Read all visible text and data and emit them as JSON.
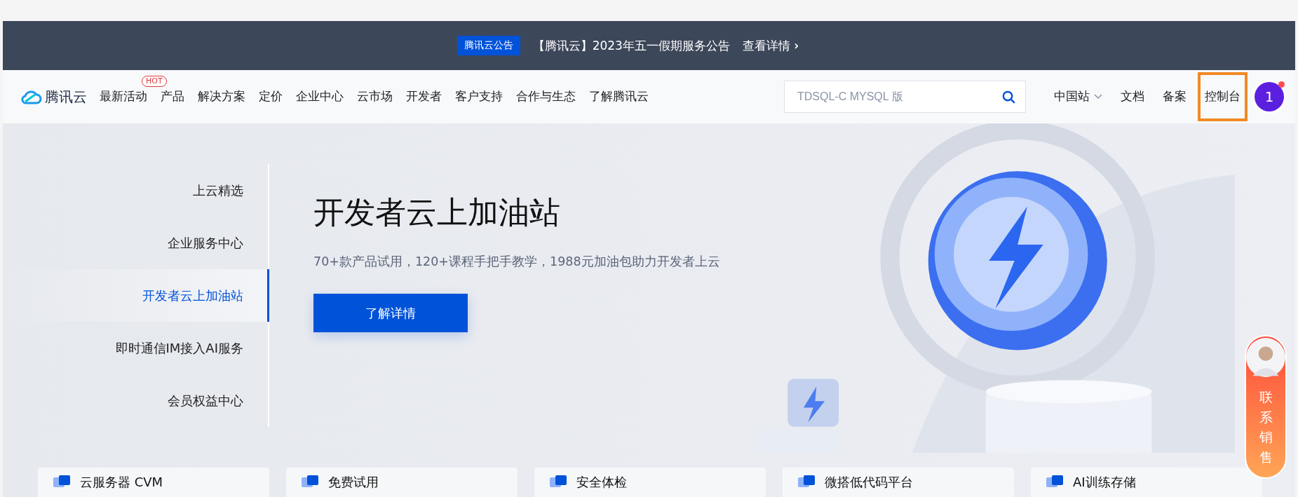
{
  "announcement": {
    "tag": "腾讯云公告",
    "text": "【腾讯云】2023年五一假期服务公告",
    "link": "查看详情",
    "link_arrow": "›"
  },
  "nav": {
    "brand": "腾讯云",
    "items": [
      {
        "label": "最新活动"
      },
      {
        "label": "产品",
        "badge": "HOT"
      },
      {
        "label": "解决方案"
      },
      {
        "label": "定价"
      },
      {
        "label": "企业中心"
      },
      {
        "label": "云市场"
      },
      {
        "label": "开发者"
      },
      {
        "label": "客户支持"
      },
      {
        "label": "合作与生态"
      },
      {
        "label": "了解腾讯云"
      }
    ],
    "search": {
      "placeholder": "TDSQL-C MYSQL 版"
    },
    "right_links": [
      {
        "label": "中国站",
        "kind": "dropdown",
        "highlighted": false
      },
      {
        "label": "文档",
        "kind": "link",
        "highlighted": false
      },
      {
        "label": "备案",
        "kind": "link",
        "highlighted": false
      },
      {
        "label": "控制台",
        "kind": "link",
        "highlighted": true
      }
    ],
    "avatar": {
      "text": "1",
      "unread": true
    }
  },
  "hero": {
    "sidebar": [
      {
        "label": "上云精选",
        "selected": false
      },
      {
        "label": "企业服务中心",
        "selected": false
      },
      {
        "label": "开发者云上加油站",
        "selected": true
      },
      {
        "label": "即时通信IM接入AI服务",
        "selected": false
      },
      {
        "label": "会员权益中心",
        "selected": false
      }
    ],
    "title": "开发者云上加油站",
    "subtitle": "70+款产品试用，120+课程手把手教学，1988元加油包助力开发者上云",
    "button": "了解详情"
  },
  "cards": [
    {
      "label": "云服务器 CVM"
    },
    {
      "label": "免费试用"
    },
    {
      "label": "安全体检"
    },
    {
      "label": "微搭低代码平台"
    },
    {
      "label": "AI训练存储"
    }
  ],
  "contact": {
    "label": "联系销售"
  }
}
